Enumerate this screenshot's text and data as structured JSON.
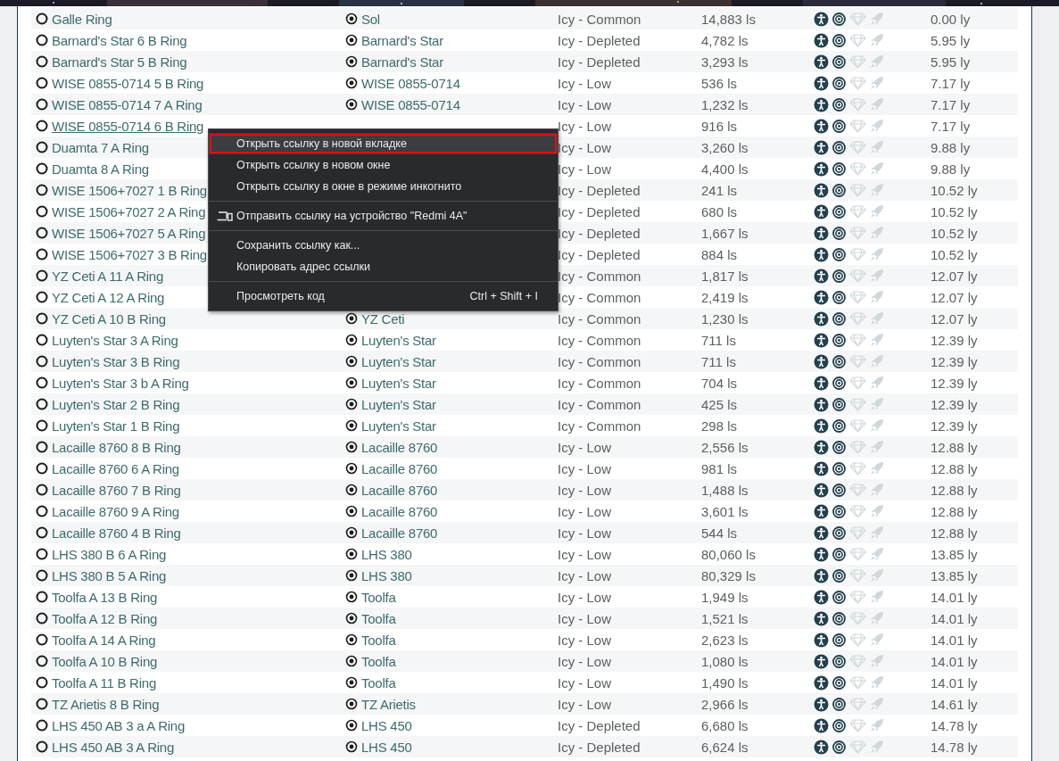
{
  "rows": [
    {
      "name": "Galle Ring",
      "hovered": false,
      "system": "Sol",
      "type": "Icy - Common",
      "distance": "14,883 ls",
      "range": "0.00 ly",
      "markers": [
        {
          "kind": "figure",
          "on": true
        },
        {
          "kind": "target",
          "on": true
        },
        {
          "kind": "diamond",
          "on": false
        },
        {
          "kind": "rocket",
          "on": false
        }
      ]
    },
    {
      "name": "Barnard's Star 6 B Ring",
      "hovered": false,
      "system": "Barnard's Star",
      "type": "Icy - Depleted",
      "distance": "4,782 ls",
      "range": "5.95 ly",
      "markers": [
        {
          "kind": "figure",
          "on": true
        },
        {
          "kind": "target",
          "on": true
        },
        {
          "kind": "diamond",
          "on": false
        },
        {
          "kind": "rocket",
          "on": false
        }
      ]
    },
    {
      "name": "Barnard's Star 5 B Ring",
      "hovered": false,
      "system": "Barnard's Star",
      "type": "Icy - Depleted",
      "distance": "3,293 ls",
      "range": "5.95 ly",
      "markers": [
        {
          "kind": "figure",
          "on": true
        },
        {
          "kind": "target",
          "on": true
        },
        {
          "kind": "diamond",
          "on": false
        },
        {
          "kind": "rocket",
          "on": false
        }
      ]
    },
    {
      "name": "WISE 0855-0714 5 B Ring",
      "hovered": false,
      "system": "WISE 0855-0714",
      "type": "Icy - Low",
      "distance": "536 ls",
      "range": "7.17 ly",
      "markers": [
        {
          "kind": "figure",
          "on": true
        },
        {
          "kind": "target",
          "on": true
        },
        {
          "kind": "diamond",
          "on": false
        },
        {
          "kind": "rocket",
          "on": false
        }
      ]
    },
    {
      "name": "WISE 0855-0714 7 A Ring",
      "hovered": false,
      "system": "WISE 0855-0714",
      "type": "Icy - Low",
      "distance": "1,232 ls",
      "range": "7.17 ly",
      "markers": [
        {
          "kind": "figure",
          "on": true
        },
        {
          "kind": "target",
          "on": true
        },
        {
          "kind": "diamond",
          "on": false
        },
        {
          "kind": "rocket",
          "on": false
        }
      ]
    },
    {
      "name": "WISE 0855-0714 6 B Ring",
      "hovered": true,
      "type": "Icy - Low",
      "distance": "916 ls",
      "range": "7.17 ly",
      "markers": [
        {
          "kind": "figure",
          "on": true
        },
        {
          "kind": "target",
          "on": true
        },
        {
          "kind": "diamond",
          "on": false
        },
        {
          "kind": "rocket",
          "on": false
        }
      ]
    },
    {
      "name": "Duamta 7 A Ring",
      "hovered": false,
      "type": "Icy - Low",
      "distance": "3,260 ls",
      "range": "9.88 ly",
      "markers": [
        {
          "kind": "figure",
          "on": true
        },
        {
          "kind": "target",
          "on": true
        },
        {
          "kind": "diamond",
          "on": false
        },
        {
          "kind": "rocket",
          "on": false
        }
      ]
    },
    {
      "name": "Duamta 8 A Ring",
      "hovered": false,
      "type": "Icy - Low",
      "distance": "4,400 ls",
      "range": "9.88 ly",
      "markers": [
        {
          "kind": "figure",
          "on": true
        },
        {
          "kind": "target",
          "on": true
        },
        {
          "kind": "diamond",
          "on": false
        },
        {
          "kind": "rocket",
          "on": false
        }
      ]
    },
    {
      "name": "WISE 1506+7027 1 B Ring",
      "hovered": false,
      "type": "Icy - Depleted",
      "distance": "241 ls",
      "range": "10.52 ly",
      "markers": [
        {
          "kind": "figure",
          "on": true
        },
        {
          "kind": "target",
          "on": true
        },
        {
          "kind": "diamond",
          "on": false
        },
        {
          "kind": "rocket",
          "on": false
        }
      ]
    },
    {
      "name": "WISE 1506+7027 2 A Ring",
      "hovered": false,
      "type": "Icy - Depleted",
      "distance": "680 ls",
      "range": "10.52 ly",
      "markers": [
        {
          "kind": "figure",
          "on": true
        },
        {
          "kind": "target",
          "on": true
        },
        {
          "kind": "diamond",
          "on": false
        },
        {
          "kind": "rocket",
          "on": false
        }
      ]
    },
    {
      "name": "WISE 1506+7027 5 A Ring",
      "hovered": false,
      "type": "Icy - Depleted",
      "distance": "1,667 ls",
      "range": "10.52 ly",
      "markers": [
        {
          "kind": "figure",
          "on": true
        },
        {
          "kind": "target",
          "on": true
        },
        {
          "kind": "diamond",
          "on": false
        },
        {
          "kind": "rocket",
          "on": false
        }
      ]
    },
    {
      "name": "WISE 1506+7027 3 B Ring",
      "hovered": false,
      "type": "Icy - Depleted",
      "distance": "884 ls",
      "range": "10.52 ly",
      "markers": [
        {
          "kind": "figure",
          "on": true
        },
        {
          "kind": "target",
          "on": true
        },
        {
          "kind": "diamond",
          "on": false
        },
        {
          "kind": "rocket",
          "on": false
        }
      ]
    },
    {
      "name": "YZ Ceti A 11 A Ring",
      "hovered": false,
      "type": "Icy - Common",
      "distance": "1,817 ls",
      "range": "12.07 ly",
      "markers": [
        {
          "kind": "figure",
          "on": true
        },
        {
          "kind": "target",
          "on": true
        },
        {
          "kind": "diamond",
          "on": false
        },
        {
          "kind": "rocket",
          "on": false
        }
      ]
    },
    {
      "name": "YZ Ceti A 12 A Ring",
      "hovered": false,
      "type": "Icy - Common",
      "distance": "2,419 ls",
      "range": "12.07 ly",
      "markers": [
        {
          "kind": "figure",
          "on": true
        },
        {
          "kind": "target",
          "on": true
        },
        {
          "kind": "diamond",
          "on": false
        },
        {
          "kind": "rocket",
          "on": false
        }
      ]
    },
    {
      "name": "YZ Ceti A 10 B Ring",
      "hovered": false,
      "system": "YZ Ceti",
      "type": "Icy - Common",
      "distance": "1,230 ls",
      "range": "12.07 ly",
      "markers": [
        {
          "kind": "figure",
          "on": true
        },
        {
          "kind": "target",
          "on": true
        },
        {
          "kind": "diamond",
          "on": false
        },
        {
          "kind": "rocket",
          "on": false
        }
      ]
    },
    {
      "name": "Luyten's Star 3 A Ring",
      "hovered": false,
      "system": "Luyten's Star",
      "type": "Icy - Common",
      "distance": "711 ls",
      "range": "12.39 ly",
      "markers": [
        {
          "kind": "figure",
          "on": true
        },
        {
          "kind": "target",
          "on": true
        },
        {
          "kind": "diamond",
          "on": false
        },
        {
          "kind": "rocket",
          "on": false
        }
      ]
    },
    {
      "name": "Luyten's Star 3 B Ring",
      "hovered": false,
      "system": "Luyten's Star",
      "type": "Icy - Common",
      "distance": "711 ls",
      "range": "12.39 ly",
      "markers": [
        {
          "kind": "figure",
          "on": true
        },
        {
          "kind": "target",
          "on": true
        },
        {
          "kind": "diamond",
          "on": false
        },
        {
          "kind": "rocket",
          "on": false
        }
      ]
    },
    {
      "name": "Luyten's Star 3 b A Ring",
      "hovered": false,
      "system": "Luyten's Star",
      "type": "Icy - Common",
      "distance": "704 ls",
      "range": "12.39 ly",
      "markers": [
        {
          "kind": "figure",
          "on": true
        },
        {
          "kind": "target",
          "on": true
        },
        {
          "kind": "diamond",
          "on": false
        },
        {
          "kind": "rocket",
          "on": false
        }
      ]
    },
    {
      "name": "Luyten's Star 2 B Ring",
      "hovered": false,
      "system": "Luyten's Star",
      "type": "Icy - Common",
      "distance": "425 ls",
      "range": "12.39 ly",
      "markers": [
        {
          "kind": "figure",
          "on": true
        },
        {
          "kind": "target",
          "on": true
        },
        {
          "kind": "diamond",
          "on": false
        },
        {
          "kind": "rocket",
          "on": false
        }
      ]
    },
    {
      "name": "Luyten's Star 1 B Ring",
      "hovered": false,
      "system": "Luyten's Star",
      "type": "Icy - Common",
      "distance": "298 ls",
      "range": "12.39 ly",
      "markers": [
        {
          "kind": "figure",
          "on": true
        },
        {
          "kind": "target",
          "on": true
        },
        {
          "kind": "diamond",
          "on": false
        },
        {
          "kind": "rocket",
          "on": false
        }
      ]
    },
    {
      "name": "Lacaille 8760 8 B Ring",
      "hovered": false,
      "system": "Lacaille 8760",
      "type": "Icy - Low",
      "distance": "2,556 ls",
      "range": "12.88 ly",
      "markers": [
        {
          "kind": "figure",
          "on": true
        },
        {
          "kind": "target",
          "on": true
        },
        {
          "kind": "diamond",
          "on": false
        },
        {
          "kind": "rocket",
          "on": false
        }
      ]
    },
    {
      "name": "Lacaille 8760 6 A Ring",
      "hovered": false,
      "system": "Lacaille 8760",
      "type": "Icy - Low",
      "distance": "981 ls",
      "range": "12.88 ly",
      "markers": [
        {
          "kind": "figure",
          "on": true
        },
        {
          "kind": "target",
          "on": true
        },
        {
          "kind": "diamond",
          "on": false
        },
        {
          "kind": "rocket",
          "on": false
        }
      ]
    },
    {
      "name": "Lacaille 8760 7 B Ring",
      "hovered": false,
      "system": "Lacaille 8760",
      "type": "Icy - Low",
      "distance": "1,488 ls",
      "range": "12.88 ly",
      "markers": [
        {
          "kind": "figure",
          "on": true
        },
        {
          "kind": "target",
          "on": true
        },
        {
          "kind": "diamond",
          "on": false
        },
        {
          "kind": "rocket",
          "on": false
        }
      ]
    },
    {
      "name": "Lacaille 8760 9 A Ring",
      "hovered": false,
      "system": "Lacaille 8760",
      "type": "Icy - Low",
      "distance": "3,601 ls",
      "range": "12.88 ly",
      "markers": [
        {
          "kind": "figure",
          "on": true
        },
        {
          "kind": "target",
          "on": true
        },
        {
          "kind": "diamond",
          "on": false
        },
        {
          "kind": "rocket",
          "on": false
        }
      ]
    },
    {
      "name": "Lacaille 8760 4 B Ring",
      "hovered": false,
      "system": "Lacaille 8760",
      "type": "Icy - Low",
      "distance": "544 ls",
      "range": "12.88 ly",
      "markers": [
        {
          "kind": "figure",
          "on": true
        },
        {
          "kind": "target",
          "on": true
        },
        {
          "kind": "diamond",
          "on": false
        },
        {
          "kind": "rocket",
          "on": false
        }
      ]
    },
    {
      "name": "LHS 380 B 6 A Ring",
      "hovered": false,
      "system": "LHS 380",
      "type": "Icy - Low",
      "distance": "80,060 ls",
      "range": "13.85 ly",
      "markers": [
        {
          "kind": "figure",
          "on": true
        },
        {
          "kind": "target",
          "on": true
        },
        {
          "kind": "diamond",
          "on": false
        },
        {
          "kind": "rocket",
          "on": false
        }
      ]
    },
    {
      "name": "LHS 380 B 5 A Ring",
      "hovered": false,
      "system": "LHS 380",
      "type": "Icy - Low",
      "distance": "80,329 ls",
      "range": "13.85 ly",
      "markers": [
        {
          "kind": "figure",
          "on": true
        },
        {
          "kind": "target",
          "on": true
        },
        {
          "kind": "diamond",
          "on": false
        },
        {
          "kind": "rocket",
          "on": false
        }
      ]
    },
    {
      "name": "Toolfa A 13 B Ring",
      "hovered": false,
      "system": "Toolfa",
      "type": "Icy - Low",
      "distance": "1,949 ls",
      "range": "14.01 ly",
      "markers": [
        {
          "kind": "figure",
          "on": true
        },
        {
          "kind": "target",
          "on": true
        },
        {
          "kind": "diamond",
          "on": false
        },
        {
          "kind": "rocket",
          "on": false
        }
      ]
    },
    {
      "name": "Toolfa A 12 B Ring",
      "hovered": false,
      "system": "Toolfa",
      "type": "Icy - Low",
      "distance": "1,521 ls",
      "range": "14.01 ly",
      "markers": [
        {
          "kind": "figure",
          "on": true
        },
        {
          "kind": "target",
          "on": true
        },
        {
          "kind": "diamond",
          "on": false
        },
        {
          "kind": "rocket",
          "on": false
        }
      ]
    },
    {
      "name": "Toolfa A 14 A Ring",
      "hovered": false,
      "system": "Toolfa",
      "type": "Icy - Low",
      "distance": "2,623 ls",
      "range": "14.01 ly",
      "markers": [
        {
          "kind": "figure",
          "on": true
        },
        {
          "kind": "target",
          "on": true
        },
        {
          "kind": "diamond",
          "on": false
        },
        {
          "kind": "rocket",
          "on": false
        }
      ]
    },
    {
      "name": "Toolfa A 10 B Ring",
      "hovered": false,
      "system": "Toolfa",
      "type": "Icy - Low",
      "distance": "1,080 ls",
      "range": "14.01 ly",
      "markers": [
        {
          "kind": "figure",
          "on": true
        },
        {
          "kind": "target",
          "on": true
        },
        {
          "kind": "diamond",
          "on": false
        },
        {
          "kind": "rocket",
          "on": false
        }
      ]
    },
    {
      "name": "Toolfa A 11 B Ring",
      "hovered": false,
      "system": "Toolfa",
      "type": "Icy - Low",
      "distance": "1,490 ls",
      "range": "14.01 ly",
      "markers": [
        {
          "kind": "figure",
          "on": true
        },
        {
          "kind": "target",
          "on": true
        },
        {
          "kind": "diamond",
          "on": false
        },
        {
          "kind": "rocket",
          "on": false
        }
      ]
    },
    {
      "name": "TZ Arietis 8 B Ring",
      "hovered": false,
      "system": "TZ Arietis",
      "type": "Icy - Low",
      "distance": "2,966 ls",
      "range": "14.61 ly",
      "markers": [
        {
          "kind": "figure",
          "on": true
        },
        {
          "kind": "target",
          "on": true
        },
        {
          "kind": "diamond",
          "on": false
        },
        {
          "kind": "rocket",
          "on": false
        }
      ]
    },
    {
      "name": "LHS 450 AB 3 a A Ring",
      "hovered": false,
      "system": "LHS 450",
      "type": "Icy - Depleted",
      "distance": "6,680 ls",
      "range": "14.78 ly",
      "markers": [
        {
          "kind": "figure",
          "on": true
        },
        {
          "kind": "target",
          "on": true
        },
        {
          "kind": "diamond",
          "on": false
        },
        {
          "kind": "rocket",
          "on": false
        }
      ]
    },
    {
      "name": "LHS 450 AB 3 A Ring",
      "hovered": false,
      "system": "LHS 450",
      "type": "Icy - Depleted",
      "distance": "6,624 ls",
      "range": "14.78 ly",
      "markers": [
        {
          "kind": "figure",
          "on": true
        },
        {
          "kind": "target",
          "on": true
        },
        {
          "kind": "diamond",
          "on": false
        },
        {
          "kind": "rocket",
          "on": false
        }
      ]
    }
  ],
  "context_menu": {
    "items": [
      {
        "kind": "item",
        "label": "Открыть ссылку в новой вкладке",
        "selected": true
      },
      {
        "kind": "item",
        "label": "Открыть ссылку в новом окне",
        "selected": false
      },
      {
        "kind": "item",
        "label": "Открыть ссылку в окне в режиме инкогнито",
        "selected": false
      },
      {
        "kind": "separator"
      },
      {
        "kind": "device",
        "label": "Отправить ссылку на устройство \"Redmi 4A\"",
        "selected": false
      },
      {
        "kind": "separator"
      },
      {
        "kind": "item",
        "label": "Сохранить ссылку как...",
        "selected": false
      },
      {
        "kind": "item",
        "label": "Копировать адрес ссылки",
        "selected": false
      },
      {
        "kind": "separator"
      },
      {
        "kind": "item",
        "label": "Просмотреть код",
        "shortcut": "Ctrl + Shift + I",
        "selected": false
      }
    ]
  }
}
